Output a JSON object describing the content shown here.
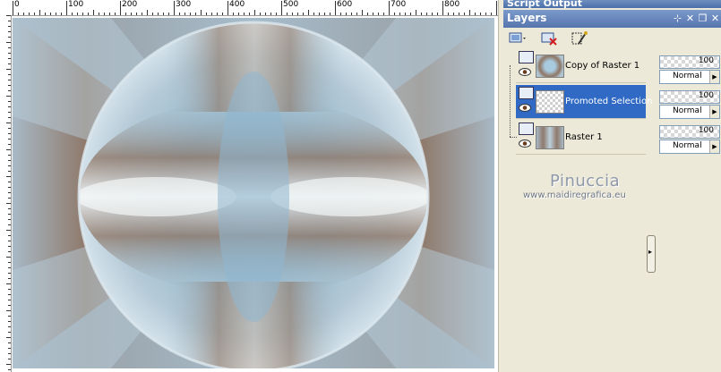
{
  "ruler": {
    "labels": [
      "0",
      "100",
      "200",
      "300",
      "400",
      "500",
      "600",
      "700",
      "800"
    ]
  },
  "script_output": {
    "title": "Script Output"
  },
  "layers_panel": {
    "title": "Layers",
    "header_buttons": [
      "pin-icon",
      "close-icon",
      "restore-icon",
      "close-panel-icon"
    ],
    "toolbar": [
      "new-layer-icon",
      "delete-layer-icon",
      "edit-layer-icon"
    ],
    "layers": [
      {
        "name": "Copy of Raster 1",
        "opacity": "100",
        "blend": "Normal",
        "selected": false
      },
      {
        "name": "Promoted Selection",
        "opacity": "100",
        "blend": "Normal",
        "selected": true
      },
      {
        "name": "Raster 1",
        "opacity": "100",
        "blend": "Normal",
        "selected": false
      }
    ]
  },
  "watermark": {
    "name": "Pinuccia",
    "url": "www.maidiregrafica.eu"
  },
  "colors": {
    "selection": "#316ac5",
    "panel_bg": "#ece9d8",
    "title_bar": "#5575ad"
  }
}
